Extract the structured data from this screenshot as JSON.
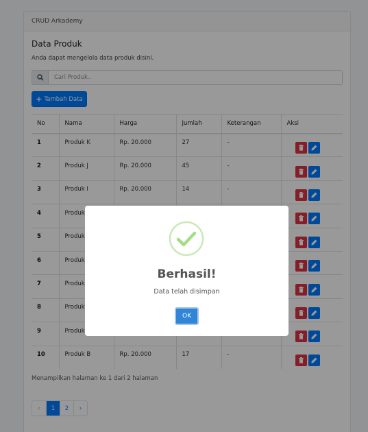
{
  "app": {
    "header": "CRUD Arkademy"
  },
  "main": {
    "title": "Data Produk",
    "subtitle": "Anda dapat mengelola data produk disini.",
    "search": {
      "placeholder": "Cari Produk.."
    },
    "add_label": "Tambah Data"
  },
  "table": {
    "columns": [
      "No",
      "Nama",
      "Harga",
      "Jumlah",
      "Keterangan",
      "Aksi"
    ],
    "rows": [
      {
        "no": "1",
        "nama": "Produk K",
        "harga": "Rp. 20.000",
        "jumlah": "27",
        "ket": "-"
      },
      {
        "no": "2",
        "nama": "Produk J",
        "harga": "Rp. 20.000",
        "jumlah": "45",
        "ket": "-"
      },
      {
        "no": "3",
        "nama": "Produk I",
        "harga": "Rp. 20.000",
        "jumlah": "14",
        "ket": "-"
      },
      {
        "no": "4",
        "nama": "Produk",
        "harga": "",
        "jumlah": "",
        "ket": ""
      },
      {
        "no": "5",
        "nama": "Produk",
        "harga": "",
        "jumlah": "",
        "ket": ""
      },
      {
        "no": "6",
        "nama": "Produk",
        "harga": "",
        "jumlah": "",
        "ket": ""
      },
      {
        "no": "7",
        "nama": "Produk",
        "harga": "",
        "jumlah": "",
        "ket": ""
      },
      {
        "no": "8",
        "nama": "Produk",
        "harga": "",
        "jumlah": "",
        "ket": ""
      },
      {
        "no": "9",
        "nama": "Produk",
        "harga": "",
        "jumlah": "",
        "ket": ""
      },
      {
        "no": "10",
        "nama": "Produk B",
        "harga": "Rp. 20.000",
        "jumlah": "17",
        "ket": "-"
      }
    ]
  },
  "pagination": {
    "info": "Menampilkan halaman ke 1 dari 2 halaman",
    "prev": "‹",
    "pages": [
      "1",
      "2"
    ],
    "next": "›",
    "active_page": "1"
  },
  "modal": {
    "title": "Berhasil!",
    "text": "Data telah disimpan",
    "ok_label": "OK"
  },
  "colors": {
    "primary": "#007bff",
    "danger": "#dc3545",
    "success": "#a5dc86",
    "confirm": "#3085d6"
  },
  "icons": {
    "search": "search-icon",
    "add": "plus-icon",
    "delete": "trash-icon",
    "edit": "pencil-icon",
    "success": "check-icon"
  }
}
